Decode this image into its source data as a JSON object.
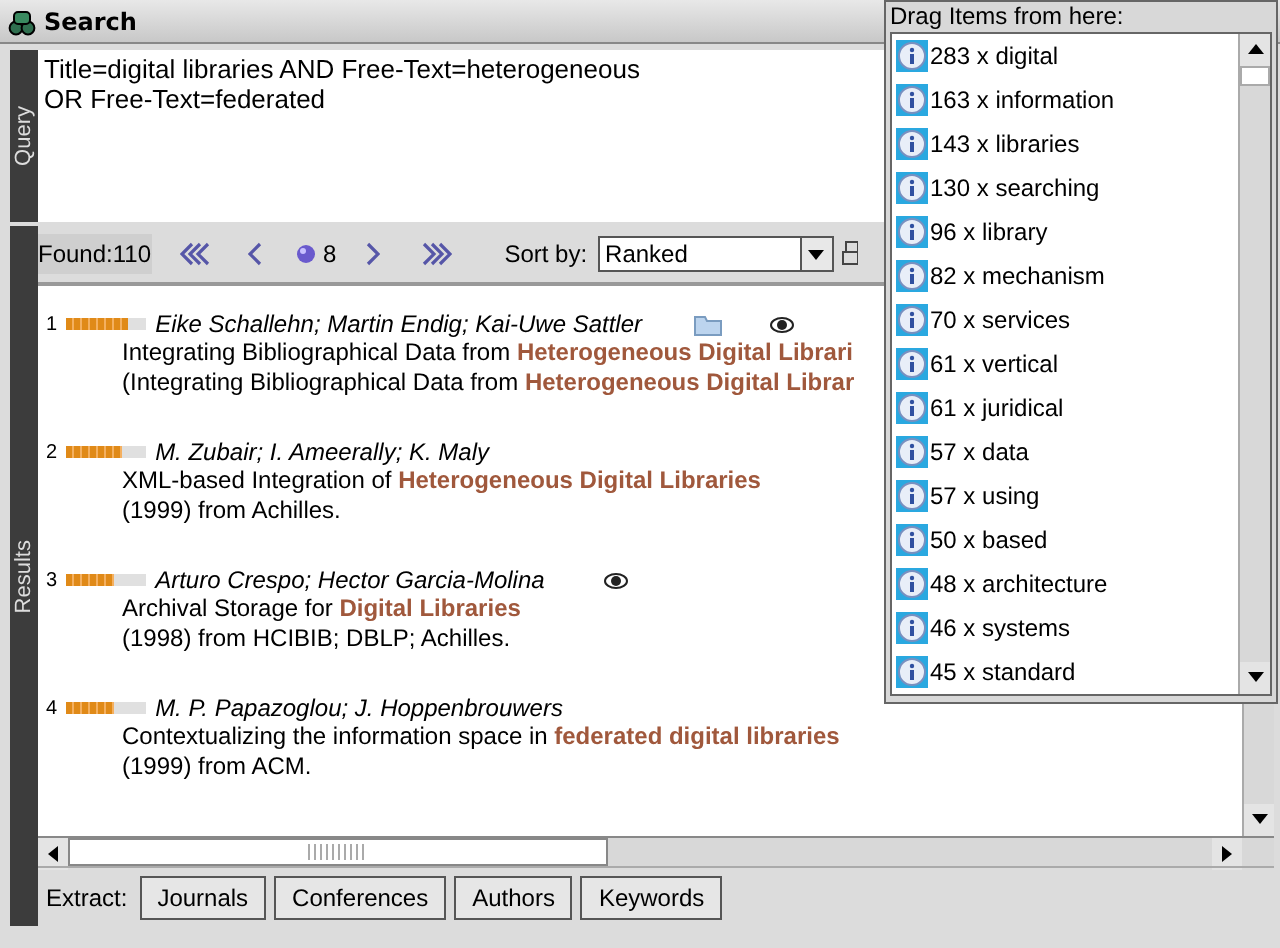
{
  "window": {
    "title": "Search"
  },
  "query": {
    "label": "Query",
    "lines": [
      "Title=digital libraries AND Free-Text=heterogeneous",
      "OR Free-Text=federated"
    ]
  },
  "toolbar": {
    "found": "Found:110",
    "page": "8",
    "sort_label": "Sort by:",
    "sort_value": "Ranked"
  },
  "results": {
    "label": "Results",
    "items": [
      {
        "number": "1",
        "level": 0.78,
        "authors": "Eike Schallehn; Martin Endig; Kai-Uwe Sattler",
        "folder": true,
        "eye": true,
        "title": "Integrating Bibliographical Data from **Heterogeneous Digital Librari**",
        "source": "(Integrating Bibliographical Data from **Heterogeneous Digital Librar**"
      },
      {
        "number": "2",
        "level": 0.7,
        "authors": "M. Zubair; I. Ameerally; K. Maly",
        "folder": false,
        "eye": false,
        "title": "XML-based Integration of **Heterogeneous Digital Libraries**",
        "source": "(1999) from Achilles."
      },
      {
        "number": "3",
        "level": 0.6,
        "authors": "Arturo Crespo; Hector Garcia-Molina",
        "folder": false,
        "eye": true,
        "title": "Archival Storage for **Digital Libraries**",
        "source": "(1998) from HCIBIB; DBLP; Achilles."
      },
      {
        "number": "4",
        "level": 0.6,
        "authors": "M. P. Papazoglou; J. Hoppenbrouwers",
        "folder": false,
        "eye": false,
        "title": "Contextualizing the information space in **federated digital libraries**",
        "source": "(1999) from ACM."
      }
    ]
  },
  "extract": {
    "label": "Extract:",
    "buttons": [
      "Journals",
      "Conferences",
      "Authors",
      "Keywords"
    ]
  },
  "drag_panel": {
    "title": "Drag Items from here:",
    "items": [
      "283 x digital",
      "163 x information",
      "143 x libraries",
      "130 x searching",
      "96 x library",
      "82 x mechanism",
      "70 x services",
      "61 x vertical",
      "61 x juridical",
      "57 x data",
      "57 x using",
      "50 x based",
      "48 x architecture",
      "46 x systems",
      "45 x standard"
    ]
  }
}
